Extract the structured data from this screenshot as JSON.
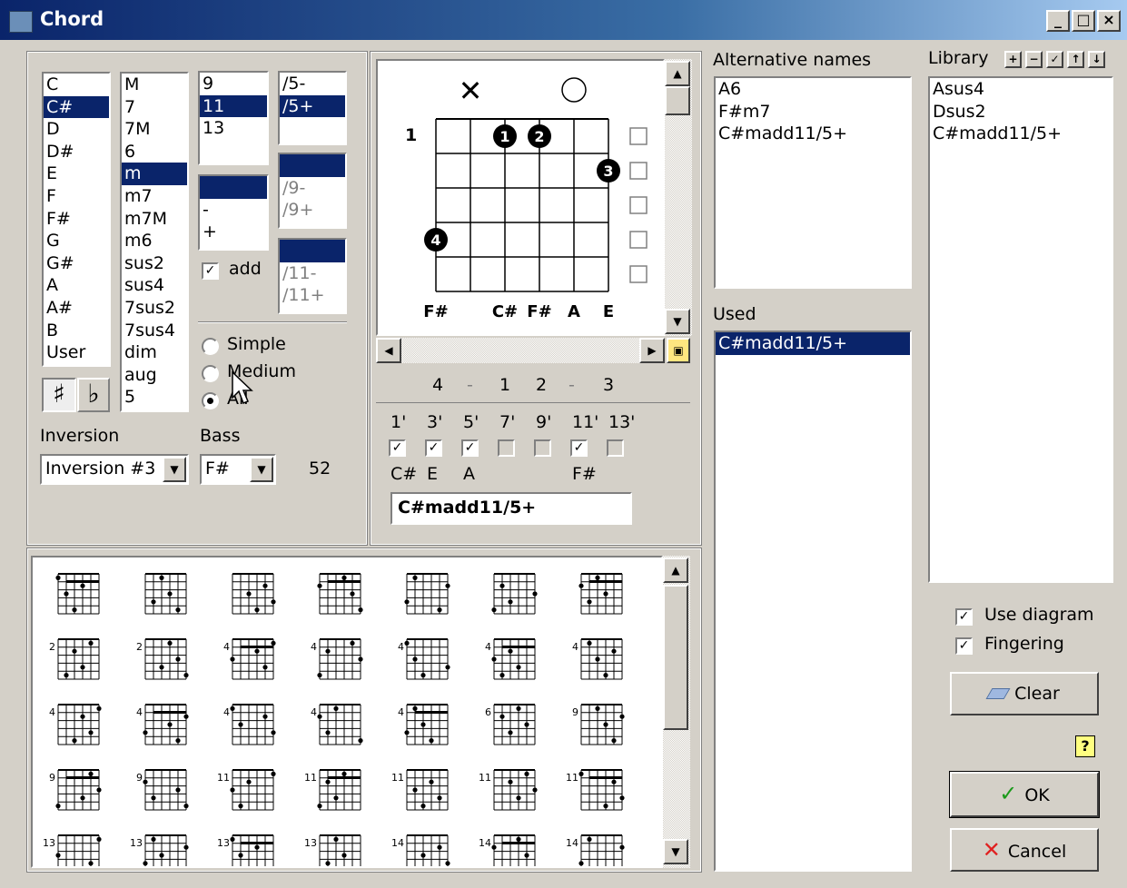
{
  "window": {
    "title": "Chord",
    "minimize": "_",
    "maximize": "□",
    "close": "×"
  },
  "roots": [
    "C",
    "C#",
    "D",
    "D#",
    "E",
    "F",
    "F#",
    "G",
    "G#",
    "A",
    "A#",
    "B",
    "User"
  ],
  "root_selected": "C#",
  "qualities": [
    "M",
    "7",
    "7M",
    "6",
    "m",
    "m7",
    "m7M",
    "m6",
    "sus2",
    "sus4",
    "7sus2",
    "7sus4",
    "dim",
    "aug",
    "5"
  ],
  "quality_selected": "m",
  "extensions": [
    "9",
    "11",
    "13"
  ],
  "extension_selected": "11",
  "ext_mod": [
    "",
    "-",
    "+"
  ],
  "fifth": [
    "/5-",
    "/5+"
  ],
  "fifth_selected": "/5+",
  "ninth": [
    "",
    "/9-",
    "/9+"
  ],
  "eleventh": [
    "",
    "/11-",
    "/11+"
  ],
  "add_label": "add",
  "sharp_label": "♯",
  "flat_label": "♭",
  "radio": {
    "simple": "Simple",
    "medium": "Medium",
    "all": "All",
    "selected": "all"
  },
  "inversion_label": "Inversion",
  "inversion_value": "Inversion #3",
  "bass_label": "Bass",
  "bass_value": "F#",
  "count": "52",
  "diagram": {
    "fret": "1",
    "muted": "✕",
    "open": "○",
    "notes": [
      "F#",
      "",
      "C#",
      "F#",
      "A",
      "E"
    ],
    "fingers": [
      "1",
      "2",
      "3",
      "4"
    ]
  },
  "fingering": {
    "numbers": [
      "4",
      "-",
      "1",
      "2",
      "-",
      "3"
    ]
  },
  "intervals": {
    "labels": [
      "1'",
      "3'",
      "5'",
      "7'",
      "9'",
      "11'",
      "13'"
    ],
    "checked": [
      true,
      true,
      true,
      false,
      false,
      true,
      false
    ],
    "notes": [
      "C#",
      "E",
      "A",
      "",
      "",
      "F#",
      ""
    ]
  },
  "chord_name": "C#madd11/5+",
  "alternative_label": "Alternative names",
  "alternatives": [
    "A6",
    "F#m7",
    "C#madd11/5+"
  ],
  "used_label": "Used",
  "used": [
    "C#madd11/5+"
  ],
  "library_label": "Library",
  "library_buttons": [
    "+",
    "−",
    "✓",
    "↑",
    "↓"
  ],
  "library": [
    "Asus4",
    "Dsus2",
    "C#madd11/5+"
  ],
  "use_diagram": "Use diagram",
  "fingering_label": "Fingering",
  "clear": "Clear",
  "help": "?",
  "ok": "OK",
  "cancel": "Cancel",
  "gallery_fret_labels": [
    "",
    "",
    "",
    "",
    "",
    "",
    "",
    "2",
    "2",
    "4",
    "4",
    "4",
    "4",
    "4",
    "4",
    "4",
    "4",
    "4",
    "4",
    "6",
    "9",
    "9",
    "9",
    "11",
    "11",
    "11",
    "11",
    "11",
    "13",
    "13",
    "13",
    "13",
    "14",
    "14",
    "14"
  ]
}
